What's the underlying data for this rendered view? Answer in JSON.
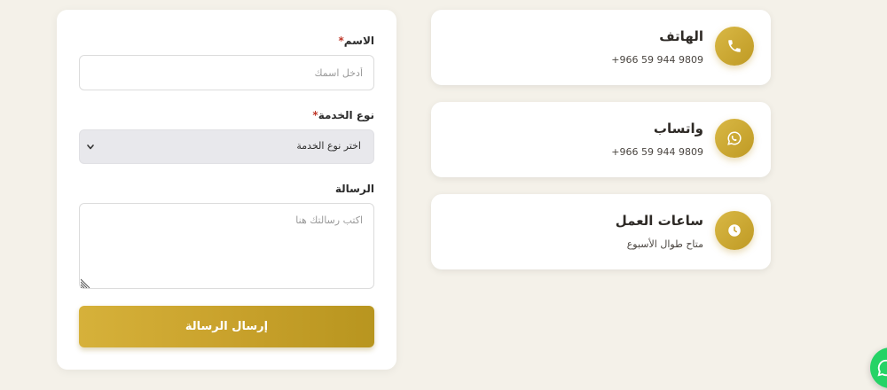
{
  "form": {
    "name_label": "الاسم",
    "name_placeholder": "أدخل اسمك",
    "service_label": "نوع الخدمة",
    "service_selected": "اختر نوع الخدمة",
    "message_label": "الرسالة",
    "message_placeholder": "اكتب رسالتك هنا",
    "required_mark": "*",
    "submit_label": "إرسال الرسالة"
  },
  "contacts": [
    {
      "title": "الهاتف",
      "value": "+966 59 944 9809",
      "icon": "phone-icon"
    },
    {
      "title": "واتساب",
      "value": "+966 59 944 9809",
      "icon": "whatsapp-icon"
    },
    {
      "title": "ساعات العمل",
      "value": "متاح طوال الأسبوع",
      "icon": "clock-icon"
    }
  ],
  "floating_button": {
    "icon": "whatsapp-icon",
    "color": "#25d366"
  },
  "colors": {
    "background": "#f4f1e9",
    "accent_gold": "#c9a22c",
    "required": "#c0392b",
    "select_bg": "#e8e8ec"
  }
}
